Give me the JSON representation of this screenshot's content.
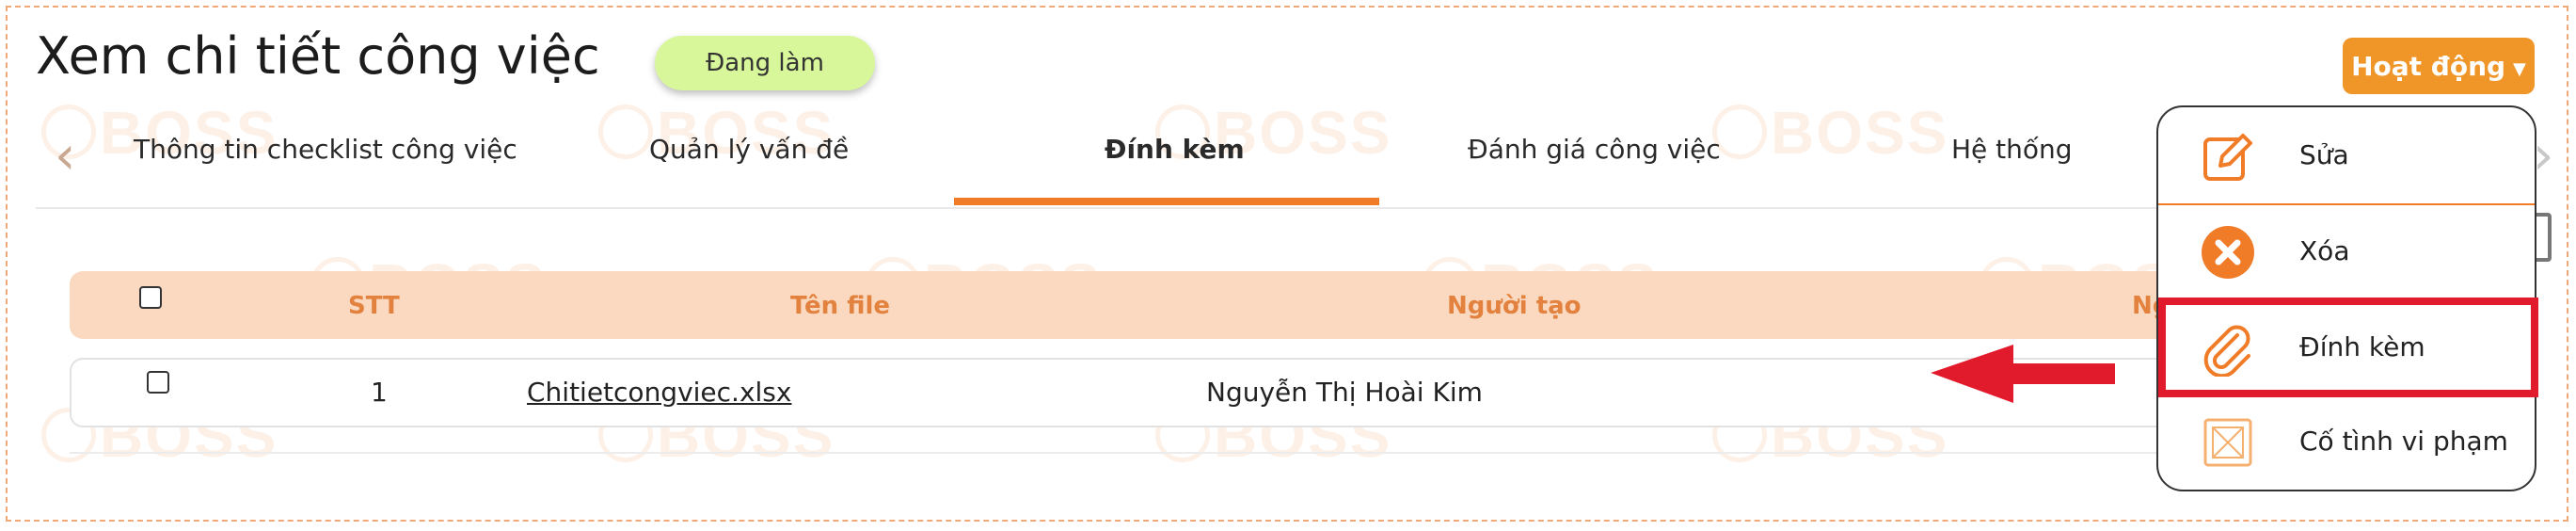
{
  "page": {
    "title": "Xem chi tiết công việc",
    "status": "Đang làm",
    "action_button": "Hoạt động"
  },
  "watermark": "BOSS",
  "tabs": [
    {
      "label": "Thông tin checklist công việc",
      "active": false
    },
    {
      "label": "Quản lý vấn đề",
      "active": false
    },
    {
      "label": "Đính kèm",
      "active": true
    },
    {
      "label": "Đánh giá công việc",
      "active": false
    },
    {
      "label": "Hệ thống",
      "active": false
    }
  ],
  "table": {
    "headers": [
      "STT",
      "Tên file",
      "Người tạo",
      "Ng"
    ],
    "rows": [
      {
        "stt": "1",
        "file": "Chitietcongviec.xlsx",
        "creator": "Nguyễn Thị Hoài Kim"
      }
    ]
  },
  "dropdown": {
    "items": [
      {
        "label": "Sửa",
        "icon": "edit-icon"
      },
      {
        "label": "Xóa",
        "icon": "delete-icon"
      },
      {
        "label": "Đính kèm",
        "icon": "paperclip-icon",
        "highlighted": true
      },
      {
        "label": "Cố tình vi phạm",
        "icon": "violation-icon"
      }
    ]
  },
  "colors": {
    "accent": "#f07c28",
    "action_button": "#f09528",
    "status_badge": "#d8f79a",
    "table_header_bg": "#fbd8c0",
    "highlight": "#e21b2c"
  }
}
